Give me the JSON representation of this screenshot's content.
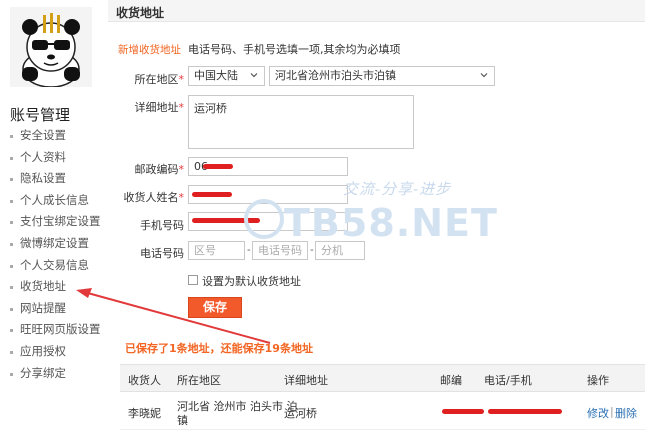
{
  "sidebar": {
    "title": "账号管理",
    "items": [
      {
        "label": "安全设置"
      },
      {
        "label": "个人资料"
      },
      {
        "label": "隐私设置"
      },
      {
        "label": "个人成长信息"
      },
      {
        "label": "支付宝绑定设置"
      },
      {
        "label": "微博绑定设置"
      },
      {
        "label": "个人交易信息"
      },
      {
        "label": "收货地址"
      },
      {
        "label": "网站提醒"
      },
      {
        "label": "旺旺网页版设置"
      },
      {
        "label": "应用授权"
      },
      {
        "label": "分享绑定"
      }
    ]
  },
  "main": {
    "title": "收货地址",
    "new_address_label": "新增收货地址",
    "hint": "电话号码、手机号选填一项,其余均为必填项"
  },
  "form": {
    "region": {
      "label": "所在地区",
      "country": "中国大陆",
      "area": "河北省沧州市泊头市泊镇"
    },
    "detail": {
      "label": "详细地址",
      "value": "运河桥"
    },
    "postcode": {
      "label": "邮政编码",
      "value": "06"
    },
    "receiver": {
      "label": "收货人姓名"
    },
    "mobile": {
      "label": "手机号码"
    },
    "phone": {
      "label": "电话号码",
      "area_placeholder": "区号",
      "number_placeholder": "电话号码",
      "ext_placeholder": "分机"
    },
    "default_checkbox": {
      "label": "设置为默认收货地址",
      "checked": false
    },
    "save_label": "保存",
    "required_mark": "*",
    "dash": "-"
  },
  "saved_note": "已保存了1条地址，还能保存19条地址",
  "table": {
    "headers": [
      "收货人",
      "所在地区",
      "详细地址",
      "邮编",
      "电话/手机",
      "操作"
    ],
    "rows": [
      {
        "receiver": "李晓妮",
        "region_line1": "河北省 沧州市 泊头市 泊",
        "region_line2": "镇",
        "detail": "运河桥",
        "edit": "修改",
        "sep": "|",
        "delete": "删除"
      }
    ]
  },
  "watermark": {
    "slogan": "交流-分享-进步",
    "site": "TB58.NET"
  },
  "colors": {
    "accent": "#f26522",
    "button": "#f35a2b",
    "required": "#e4393c",
    "link": "#2a6fb3",
    "redact": "#e02020"
  }
}
